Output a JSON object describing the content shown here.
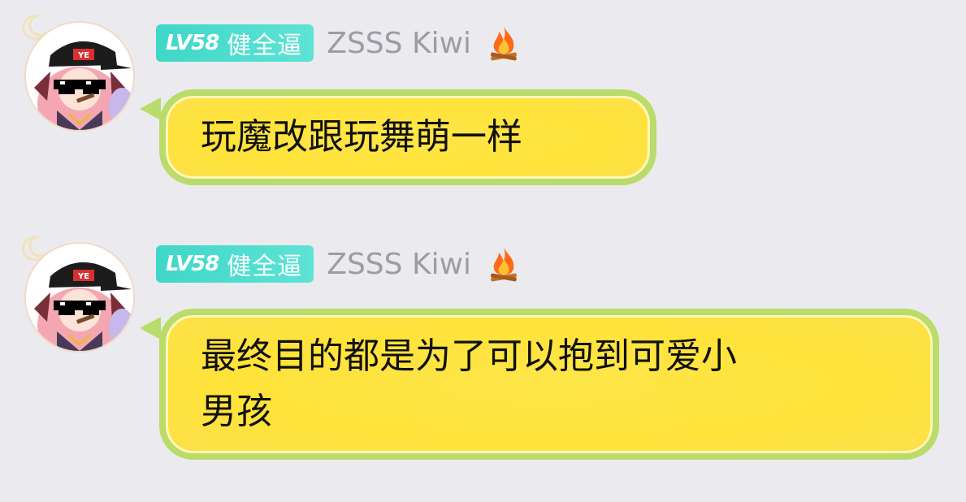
{
  "messages": [
    {
      "level_badge": "LV58",
      "title_badge": "健全逼",
      "username": "ZSSS Kiwi",
      "status_icon": "fire-icon",
      "text": "玩魔改跟玩舞萌一样"
    },
    {
      "level_badge": "LV58",
      "title_badge": "健全逼",
      "username": "ZSSS Kiwi",
      "status_icon": "fire-icon",
      "text": "最终目的都是为了可以抱到可爱小\n男孩"
    }
  ],
  "colors": {
    "background": "#ebebef",
    "badge": "#3fd7c8",
    "bubble_fill": "#ffe33a",
    "bubble_border": "#b9dc6a",
    "username": "#9c9ca4"
  }
}
